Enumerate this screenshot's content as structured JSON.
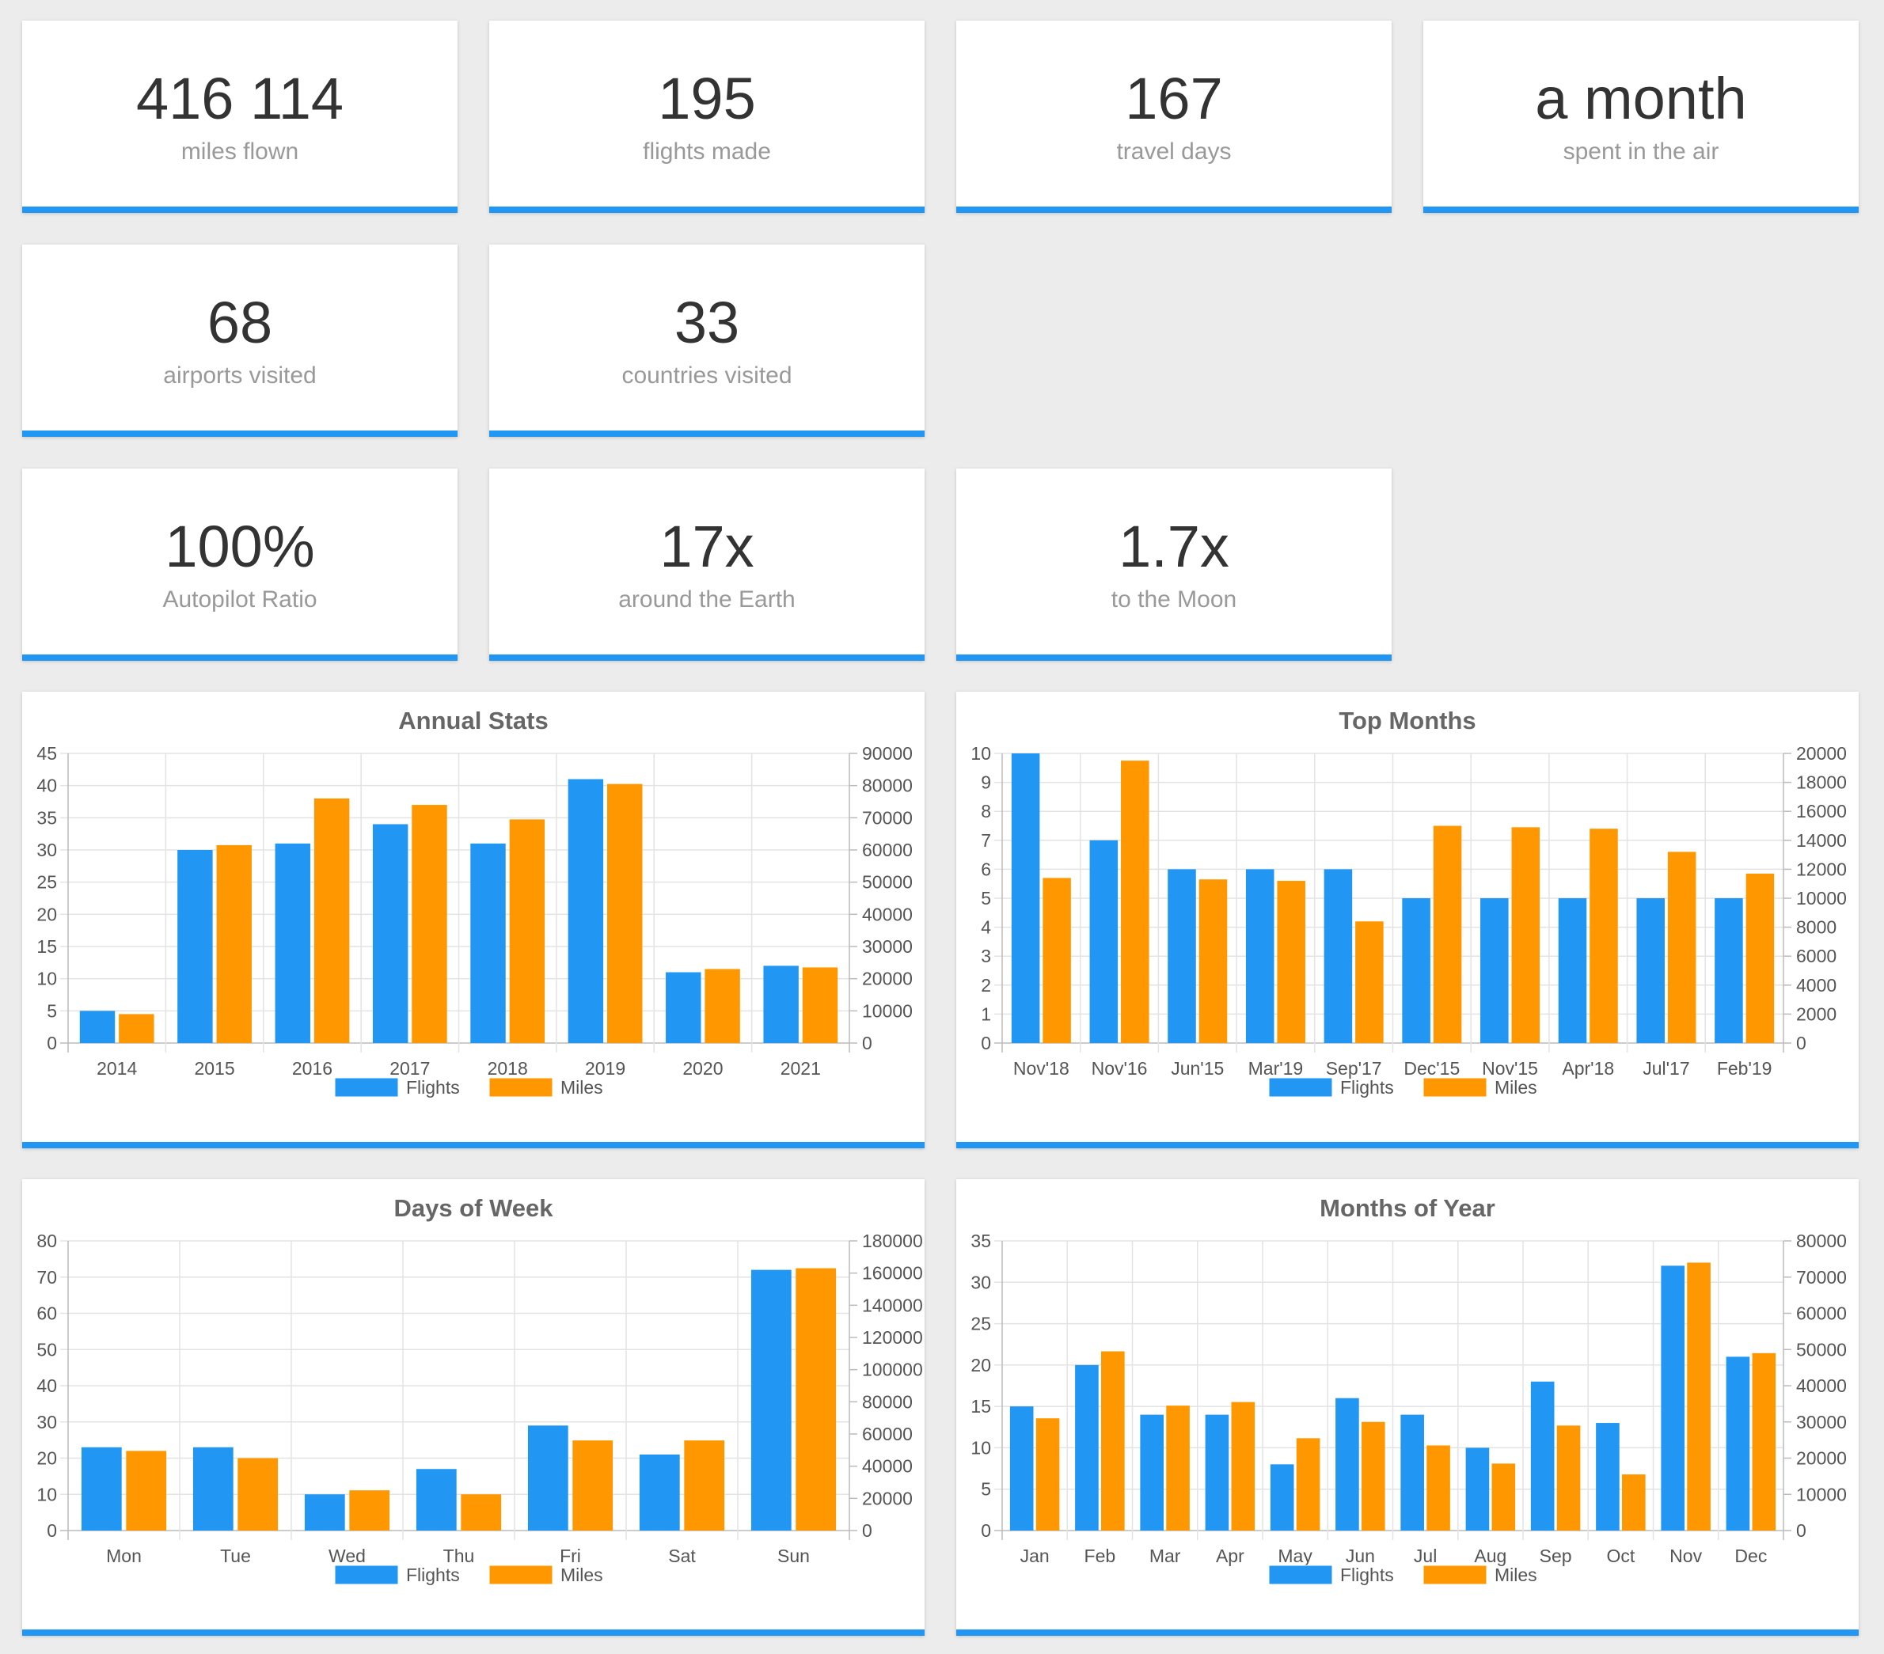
{
  "colors": {
    "flights": "#2196f3",
    "miles": "#ff9800",
    "accent": "#2196f3"
  },
  "stats": [
    {
      "value": "416 114",
      "label": "miles flown"
    },
    {
      "value": "195",
      "label": "flights made"
    },
    {
      "value": "167",
      "label": "travel days"
    },
    {
      "value": "a month",
      "label": "spent in the air"
    },
    {
      "value": "68",
      "label": "airports visited"
    },
    {
      "value": "33",
      "label": "countries visited"
    },
    {
      "value": "100%",
      "label": "Autopilot Ratio"
    },
    {
      "value": "17x",
      "label": "around the Earth"
    },
    {
      "value": "1.7x",
      "label": "to the Moon"
    }
  ],
  "chart_data": [
    {
      "type": "bar",
      "title": "Annual Stats",
      "categories": [
        "2014",
        "2015",
        "2016",
        "2017",
        "2018",
        "2019",
        "2020",
        "2021"
      ],
      "series": [
        {
          "name": "Flights",
          "axis": "left",
          "values": [
            5,
            30,
            31,
            34,
            31,
            41,
            11,
            12
          ]
        },
        {
          "name": "Miles",
          "axis": "right",
          "values": [
            9000,
            61500,
            76000,
            74000,
            69500,
            80500,
            23000,
            23500
          ]
        }
      ],
      "ylim_left": [
        0,
        45
      ],
      "yticks_left": [
        0,
        5,
        10,
        15,
        20,
        25,
        30,
        35,
        40,
        45
      ],
      "ylim_right": [
        0,
        90000
      ],
      "yticks_right": [
        0,
        10000,
        20000,
        30000,
        40000,
        50000,
        60000,
        70000,
        80000,
        90000
      ],
      "grid": true,
      "legend": "bottom"
    },
    {
      "type": "bar",
      "title": "Top Months",
      "categories": [
        "Nov'18",
        "Nov'16",
        "Jun'15",
        "Mar'19",
        "Sep'17",
        "Dec'15",
        "Nov'15",
        "Apr'18",
        "Jul'17",
        "Feb'19"
      ],
      "series": [
        {
          "name": "Flights",
          "axis": "left",
          "values": [
            10,
            7,
            6,
            6,
            6,
            5,
            5,
            5,
            5,
            5
          ]
        },
        {
          "name": "Miles",
          "axis": "right",
          "values": [
            11400,
            19500,
            11300,
            11200,
            8400,
            15000,
            14900,
            14800,
            13200,
            11700
          ]
        }
      ],
      "ylim_left": [
        0,
        10
      ],
      "yticks_left": [
        0,
        1,
        2,
        3,
        4,
        5,
        6,
        7,
        8,
        9,
        10
      ],
      "ylim_right": [
        0,
        20000
      ],
      "yticks_right": [
        0,
        2000,
        4000,
        6000,
        8000,
        10000,
        12000,
        14000,
        16000,
        18000,
        20000
      ],
      "grid": true,
      "legend": "bottom"
    },
    {
      "type": "bar",
      "title": "Days of Week",
      "categories": [
        "Mon",
        "Tue",
        "Wed",
        "Thu",
        "Fri",
        "Sat",
        "Sun"
      ],
      "series": [
        {
          "name": "Flights",
          "axis": "left",
          "values": [
            23,
            23,
            10,
            17,
            29,
            21,
            72
          ]
        },
        {
          "name": "Miles",
          "axis": "right",
          "values": [
            49500,
            45000,
            25000,
            22500,
            56000,
            56000,
            163000
          ]
        }
      ],
      "ylim_left": [
        0,
        80
      ],
      "yticks_left": [
        0,
        10,
        20,
        30,
        40,
        50,
        60,
        70,
        80
      ],
      "ylim_right": [
        0,
        180000
      ],
      "yticks_right": [
        0,
        20000,
        40000,
        60000,
        80000,
        100000,
        120000,
        140000,
        160000,
        180000
      ],
      "grid": true,
      "legend": "bottom"
    },
    {
      "type": "bar",
      "title": "Months of Year",
      "categories": [
        "Jan",
        "Feb",
        "Mar",
        "Apr",
        "May",
        "Jun",
        "Jul",
        "Aug",
        "Sep",
        "Oct",
        "Nov",
        "Dec"
      ],
      "series": [
        {
          "name": "Flights",
          "axis": "left",
          "values": [
            15,
            20,
            14,
            14,
            8,
            16,
            14,
            10,
            18,
            13,
            32,
            21
          ]
        },
        {
          "name": "Miles",
          "axis": "right",
          "values": [
            31000,
            49500,
            34500,
            35500,
            25500,
            30000,
            23500,
            18500,
            29000,
            15500,
            74000,
            49000
          ]
        }
      ],
      "ylim_left": [
        0,
        35
      ],
      "yticks_left": [
        0,
        5,
        10,
        15,
        20,
        25,
        30,
        35
      ],
      "ylim_right": [
        0,
        80000
      ],
      "yticks_right": [
        0,
        10000,
        20000,
        30000,
        40000,
        50000,
        60000,
        70000,
        80000
      ],
      "grid": true,
      "legend": "bottom"
    }
  ]
}
